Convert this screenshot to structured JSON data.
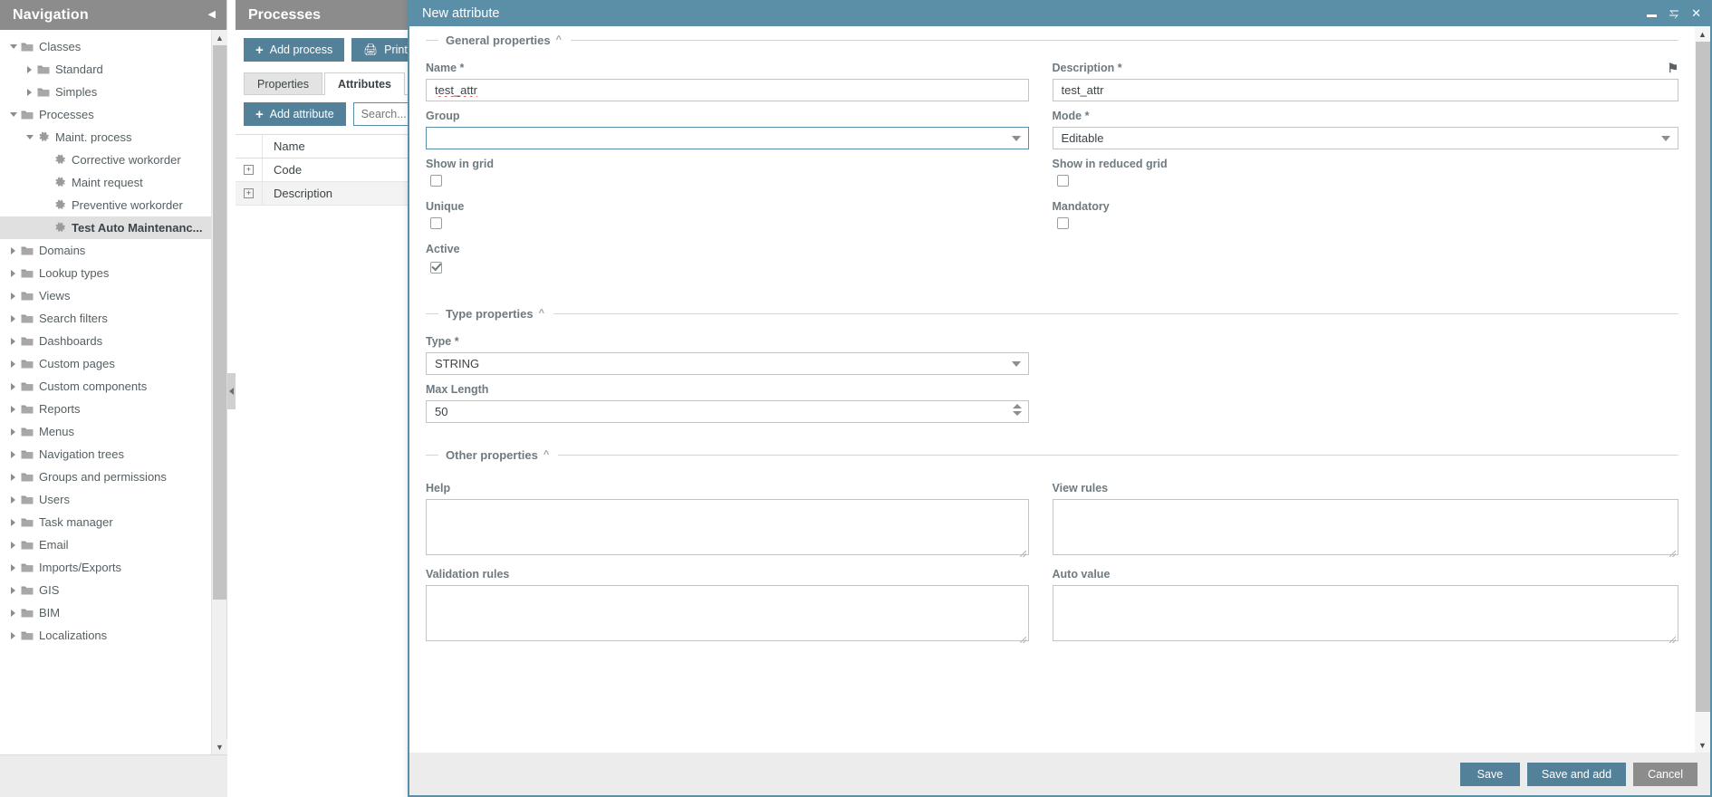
{
  "navigation": {
    "title": "Navigation",
    "collapse_icon": "chevron-left-icon",
    "tree": [
      {
        "label": "Classes",
        "indent": 0,
        "toggle": "down",
        "icon": "folder",
        "selected": false
      },
      {
        "label": "Standard",
        "indent": 1,
        "toggle": "right",
        "icon": "folder",
        "selected": false
      },
      {
        "label": "Simples",
        "indent": 1,
        "toggle": "right",
        "icon": "folder",
        "selected": false
      },
      {
        "label": "Processes",
        "indent": 0,
        "toggle": "down",
        "icon": "folder",
        "selected": false
      },
      {
        "label": "Maint. process",
        "indent": 1,
        "toggle": "down",
        "icon": "gear",
        "selected": false
      },
      {
        "label": "Corrective workorder",
        "indent": 2,
        "toggle": "none",
        "icon": "gear",
        "selected": false
      },
      {
        "label": "Maint request",
        "indent": 2,
        "toggle": "none",
        "icon": "gear",
        "selected": false
      },
      {
        "label": "Preventive workorder",
        "indent": 2,
        "toggle": "none",
        "icon": "gear",
        "selected": false
      },
      {
        "label": "Test Auto Maintenanc...",
        "indent": 2,
        "toggle": "none",
        "icon": "gear",
        "selected": true
      },
      {
        "label": "Domains",
        "indent": 0,
        "toggle": "right",
        "icon": "folder",
        "selected": false
      },
      {
        "label": "Lookup types",
        "indent": 0,
        "toggle": "right",
        "icon": "folder",
        "selected": false
      },
      {
        "label": "Views",
        "indent": 0,
        "toggle": "right",
        "icon": "folder",
        "selected": false
      },
      {
        "label": "Search filters",
        "indent": 0,
        "toggle": "right",
        "icon": "folder",
        "selected": false
      },
      {
        "label": "Dashboards",
        "indent": 0,
        "toggle": "right",
        "icon": "folder",
        "selected": false
      },
      {
        "label": "Custom pages",
        "indent": 0,
        "toggle": "right",
        "icon": "folder",
        "selected": false
      },
      {
        "label": "Custom components",
        "indent": 0,
        "toggle": "right",
        "icon": "folder",
        "selected": false
      },
      {
        "label": "Reports",
        "indent": 0,
        "toggle": "right",
        "icon": "folder",
        "selected": false
      },
      {
        "label": "Menus",
        "indent": 0,
        "toggle": "right",
        "icon": "folder",
        "selected": false
      },
      {
        "label": "Navigation trees",
        "indent": 0,
        "toggle": "right",
        "icon": "folder",
        "selected": false
      },
      {
        "label": "Groups and permissions",
        "indent": 0,
        "toggle": "right",
        "icon": "folder",
        "selected": false
      },
      {
        "label": "Users",
        "indent": 0,
        "toggle": "right",
        "icon": "folder",
        "selected": false
      },
      {
        "label": "Task manager",
        "indent": 0,
        "toggle": "right",
        "icon": "folder",
        "selected": false
      },
      {
        "label": "Email",
        "indent": 0,
        "toggle": "right",
        "icon": "folder",
        "selected": false
      },
      {
        "label": "Imports/Exports",
        "indent": 0,
        "toggle": "right",
        "icon": "folder",
        "selected": false
      },
      {
        "label": "GIS",
        "indent": 0,
        "toggle": "right",
        "icon": "folder",
        "selected": false
      },
      {
        "label": "BIM",
        "indent": 0,
        "toggle": "right",
        "icon": "folder",
        "selected": false
      },
      {
        "label": "Localizations",
        "indent": 0,
        "toggle": "right",
        "icon": "folder",
        "selected": false
      }
    ]
  },
  "processes": {
    "title": "Processes",
    "add_process_label": "Add process",
    "print_label": "Print",
    "tabs": [
      {
        "label": "Properties",
        "active": false
      },
      {
        "label": "Attributes",
        "active": true
      }
    ],
    "add_attribute_label": "Add attribute",
    "search_placeholder": "Search...",
    "grid": {
      "columns": [
        "Name"
      ],
      "rows": [
        {
          "name": "Code"
        },
        {
          "name": "Description"
        }
      ]
    }
  },
  "modal": {
    "title": "New attribute",
    "window_controls": {
      "minimize": "minimize-icon",
      "maximize": "maximize-icon",
      "close": "close-icon"
    },
    "sections": {
      "general": {
        "legend": "General properties",
        "name": {
          "label": "Name *",
          "value": "test_attr"
        },
        "description": {
          "label": "Description *",
          "value": "test_attr",
          "flag_icon": "flag-icon"
        },
        "group": {
          "label": "Group",
          "value": "",
          "focused": true
        },
        "mode": {
          "label": "Mode *",
          "value": "Editable"
        },
        "show_in_grid": {
          "label": "Show in grid",
          "checked": false
        },
        "show_in_reduced_grid": {
          "label": "Show in reduced grid",
          "checked": false
        },
        "unique": {
          "label": "Unique",
          "checked": false
        },
        "mandatory": {
          "label": "Mandatory",
          "checked": false
        },
        "active": {
          "label": "Active",
          "checked": true
        }
      },
      "type": {
        "legend": "Type properties",
        "type": {
          "label": "Type *",
          "value": "STRING"
        },
        "max_length": {
          "label": "Max Length",
          "value": "50"
        }
      },
      "other": {
        "legend": "Other properties",
        "help": {
          "label": "Help",
          "value": ""
        },
        "view_rules": {
          "label": "View rules",
          "value": ""
        },
        "validation_rules": {
          "label": "Validation rules",
          "value": ""
        },
        "auto_value": {
          "label": "Auto value",
          "value": ""
        }
      }
    },
    "footer": {
      "save": "Save",
      "save_and_add": "Save and add",
      "cancel": "Cancel"
    }
  },
  "colors": {
    "accent_teal": "#5b8fa8",
    "button_teal": "#54819a",
    "panel_header_gray": "#8c8c8c",
    "footer_gray": "#ececec",
    "secondary_gray": "#8c8c8c",
    "spellcheck_red": "#d83a3a"
  }
}
